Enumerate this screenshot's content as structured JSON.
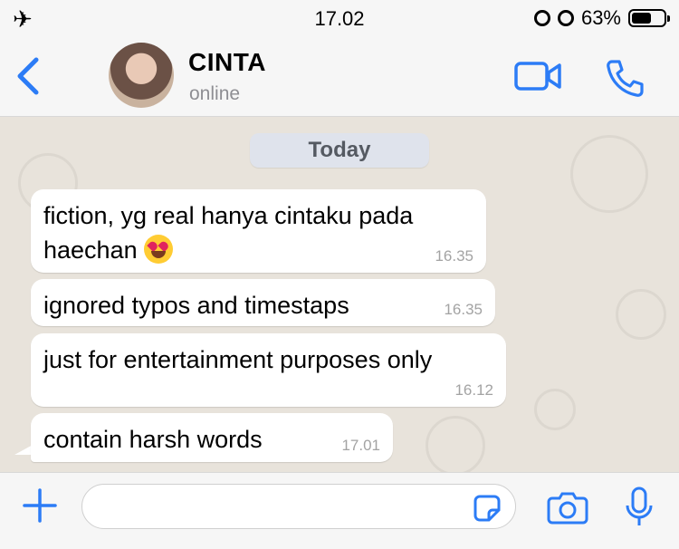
{
  "status_bar": {
    "time": "17.02",
    "battery_percent": "63%",
    "battery_level": 0.63,
    "icons": [
      "airplane-icon",
      "alarm-icon",
      "rotation-lock-icon",
      "battery-icon"
    ]
  },
  "header": {
    "contact_name": "CINTA",
    "presence": "online",
    "accent_color": "#2c7cf6"
  },
  "chat": {
    "date_label": "Today",
    "messages": [
      {
        "text": "fiction, yg real hanya cintaku pada haechan",
        "emoji": "😍",
        "time": "16.35"
      },
      {
        "text": "ignored typos and timestaps",
        "time": "16.35"
      },
      {
        "text": "just for entertainment purposes only",
        "time": "16.12"
      },
      {
        "text": "contain harsh words",
        "time": "17.01"
      }
    ]
  },
  "input_bar": {
    "message_value": "",
    "icons": [
      "plus-icon",
      "sticker-icon",
      "camera-icon",
      "microphone-icon"
    ]
  }
}
